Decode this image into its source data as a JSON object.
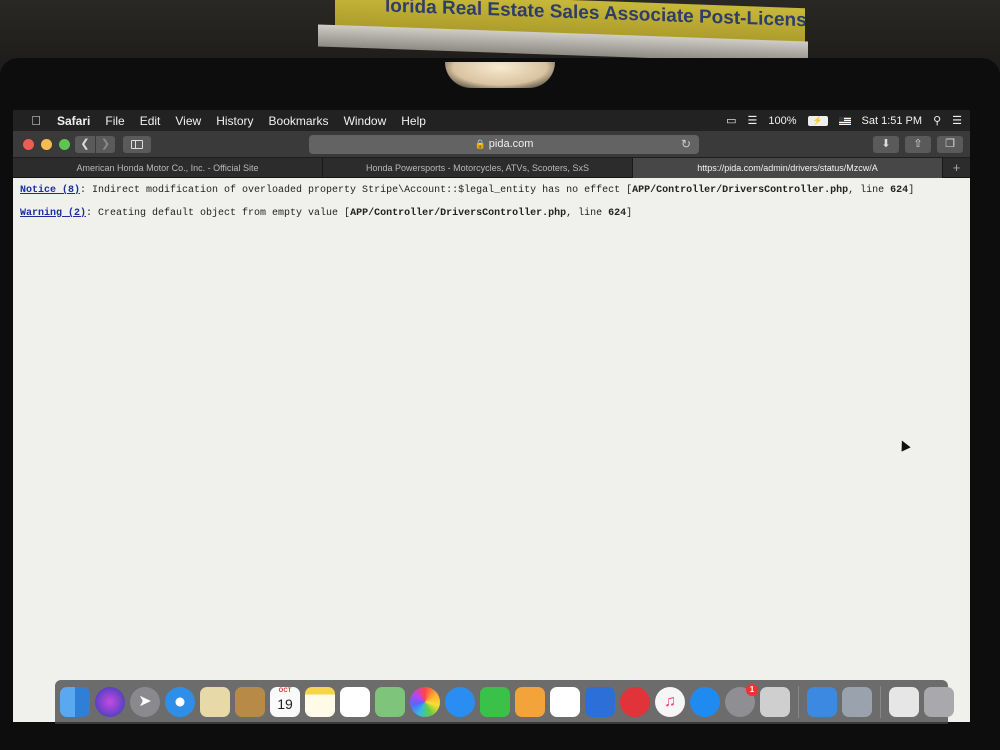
{
  "photo": {
    "book_title": "lorida Real Estate Sales Associate Post-License Course"
  },
  "menubar": {
    "apple_icon": "apple-icon",
    "app_name": "Safari",
    "items": [
      "File",
      "Edit",
      "View",
      "History",
      "Bookmarks",
      "Window",
      "Help"
    ],
    "battery": "100%",
    "clock": "Sat 1:51 PM"
  },
  "toolbar": {
    "url": "pida.com",
    "back_icon": "chevron-left-icon",
    "forward_icon": "chevron-right-icon",
    "reload_icon": "reload-icon"
  },
  "tabs": [
    {
      "label": "American Honda Motor Co., Inc. - Official Site",
      "active": false
    },
    {
      "label": "Honda Powersports - Motorcycles, ATVs, Scooters, SxS",
      "active": false
    },
    {
      "label": "https://pida.com/admin/drivers/status/Mzcw/A",
      "active": true
    }
  ],
  "page": {
    "messages": [
      {
        "level": "Notice (8)",
        "text": ": Indirect modification of overloaded property Stripe\\Account::$legal_entity has no effect [",
        "file": "APP/Controller/DriversController.php",
        "line_text": ", line ",
        "line": "624",
        "close": "]"
      },
      {
        "level": "Warning (2)",
        "text": ": Creating default object from empty value [",
        "file": "APP/Controller/DriversController.php",
        "line_text": ", line ",
        "line": "624",
        "close": "]"
      }
    ]
  },
  "dock": {
    "calendar_month": "OCT",
    "calendar_day": "19",
    "system_prefs_badge": "1"
  }
}
